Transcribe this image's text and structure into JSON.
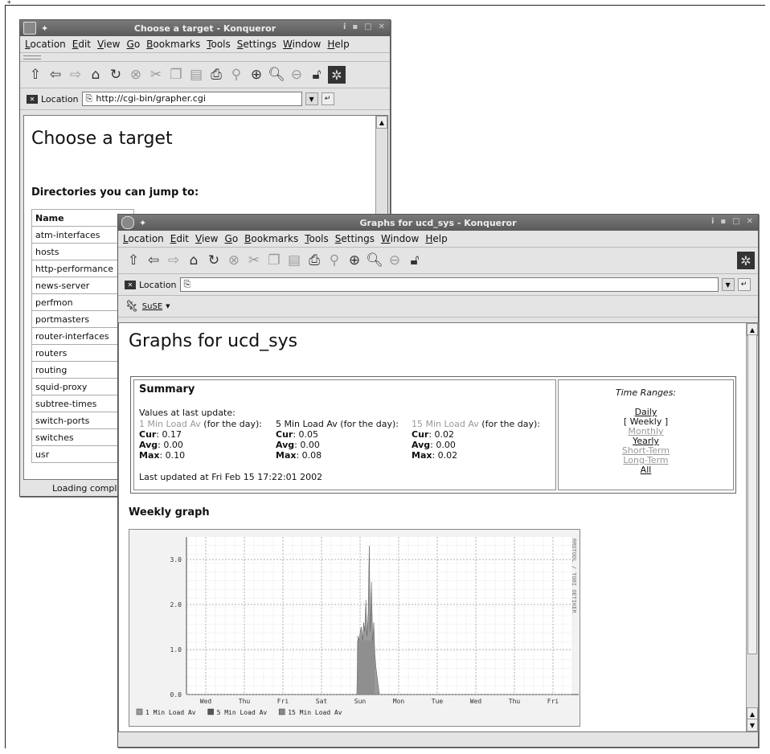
{
  "corner_mark": "*",
  "menu": [
    "Location",
    "Edit",
    "View",
    "Go",
    "Bookmarks",
    "Tools",
    "Settings",
    "Window",
    "Help"
  ],
  "win1": {
    "title": "Choose a target - Konqueror",
    "pin": "✦",
    "location_label": "Location",
    "url": "http://cgi-bin/grapher.cgi",
    "heading": "Choose a target",
    "subheading": "Directories you can jump to:",
    "table_header": "Name",
    "dirs": [
      "atm-interfaces",
      "hosts",
      "http-performance",
      "news-server",
      "perfmon",
      "portmasters",
      "router-interfaces",
      "routers",
      "routing",
      "squid-proxy",
      "subtree-times",
      "switch-ports",
      "switches",
      "usr"
    ],
    "status": "Loading comple"
  },
  "win2": {
    "title": "Graphs for ucd_sys - Konqueror",
    "pin": "✦",
    "location_label": "Location",
    "url": "",
    "bookmark": "SuSE",
    "heading": "Graphs for ucd_sys",
    "summary": {
      "title": "Summary",
      "values_label": "Values at last update:",
      "cols": [
        {
          "name": "1 Min Load Av",
          "suffix": " (for the day):",
          "cur": "0.17",
          "avg": "0.00",
          "max": "0.10"
        },
        {
          "name": "5 Min Load Av",
          "suffix": " (for the day):",
          "cur": "0.05",
          "avg": "0.00",
          "max": "0.08"
        },
        {
          "name": "15 Min Load Av",
          "suffix": " (for the day):",
          "cur": "0.02",
          "avg": "0.00",
          "max": "0.02"
        }
      ],
      "cur_label": "Cur",
      "avg_label": "Avg",
      "max_label": "Max",
      "updated": "Last updated at Fri Feb 15 17:22:01 2002"
    },
    "time_ranges": {
      "title": "Time Ranges:",
      "items": [
        "Daily",
        "[ Weekly ]",
        "Monthly",
        "Yearly",
        "Short-Term",
        "Long-Term",
        "All"
      ]
    },
    "graph_title": "Weekly graph"
  },
  "chart_data": {
    "type": "area",
    "x_ticks": [
      "Wed",
      "Thu",
      "Fri",
      "Sat",
      "Sun",
      "Mon",
      "Tue",
      "Wed",
      "Thu",
      "Fri"
    ],
    "y_ticks": [
      "0.0",
      "1.0",
      "2.0",
      "3.0"
    ],
    "ylim": [
      0,
      3.5
    ],
    "side_label": "RRDTOOL / TOBI OETIKER",
    "legend": [
      "1 Min Load Av",
      "5 Min Load Av",
      "15 Min Load Av"
    ],
    "colors": [
      "#9a9a9a",
      "#555555",
      "#888888"
    ],
    "grid": true
  }
}
